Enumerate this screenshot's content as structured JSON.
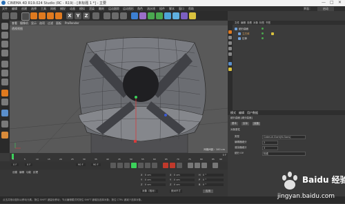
{
  "window": {
    "title": "CINEMA 4D R19.024 Studio (RC - R19) - [未标题 1 *] - 主要",
    "controls": [
      "—",
      "□",
      "✕"
    ]
  },
  "menubar": {
    "items": [
      "文件",
      "编辑",
      "创建",
      "选择",
      "工具",
      "网格",
      "捕捉",
      "动画",
      "模拟",
      "渲染",
      "雕刻",
      "运动跟踪",
      "运动图形",
      "角色",
      "流水线",
      "插件",
      "脚本",
      "窗口",
      "帮助"
    ],
    "layout_label": "界面：",
    "layout_value": "启动"
  },
  "toolbar": {
    "axis_x": "X",
    "axis_y": "Y",
    "axis_z": "Z"
  },
  "viewport": {
    "menu": [
      "查看",
      "摄像机",
      "显示",
      "选项",
      "过滤",
      "面板",
      "ProRender"
    ],
    "label": "透视视图",
    "grid_info": "网格间距：100 cm"
  },
  "object_manager": {
    "menu": [
      "文件",
      "编辑",
      "查看",
      "对象",
      "标签",
      "书签"
    ],
    "objects": [
      {
        "name": "细分曲面",
        "icon_color": "#6fa0d8"
      },
      {
        "name": "立方体",
        "icon_color": "#6fa0d8"
      },
      {
        "name": "拉伸",
        "icon_color": "#6fa0d8"
      }
    ]
  },
  "attribute_manager": {
    "tabs": [
      "模式",
      "编辑",
      "用户数据"
    ],
    "object_title": "细分曲面 [细分曲面]",
    "subtabs": [
      "基本",
      "坐标",
      "对象"
    ],
    "section": "对象属性",
    "fields": [
      {
        "label": "类型",
        "value": "Catmull-Clark(N-Gons)"
      },
      {
        "label": "编辑器细分",
        "value": "2"
      },
      {
        "label": "渲染器细分",
        "value": "3"
      },
      {
        "label": "细分 UV",
        "value": "标准"
      }
    ]
  },
  "timeline": {
    "ticks": [
      "0",
      "5",
      "10",
      "15",
      "20",
      "25",
      "30",
      "35",
      "40",
      "45",
      "50",
      "55",
      "60",
      "65",
      "70",
      "75",
      "80",
      "85",
      "90"
    ],
    "frame": "0 F"
  },
  "transport": {
    "start": "0 F",
    "current": "0 F",
    "end": "90 F",
    "end2": "90 F"
  },
  "material_manager": {
    "menu": [
      "创建",
      "编辑",
      "功能",
      "纹理"
    ]
  },
  "coord_manager": {
    "rows": [
      {
        "axis": "X",
        "value": "0 cm",
        "axis2": "X",
        "value2": "0 cm",
        "axis3": "H",
        "value3": "0 °"
      },
      {
        "axis": "Y",
        "value": "0 cm",
        "axis2": "Y",
        "value2": "0 cm",
        "axis3": "P",
        "value3": "0 °"
      },
      {
        "axis": "Z",
        "value": "0 cm",
        "axis2": "Z",
        "value2": "0 cm",
        "axis3": "B",
        "value3": "0 °"
      }
    ],
    "mode": "对象（相对）",
    "mode2": "绝对尺寸",
    "apply": "应用"
  },
  "statusbar": {
    "text": "点击并拖动鼠标以移动元素。按住 SHIFT 键量化移动；节点编辑模式时按住 SHIFT 键增加选择对象；按住 CTRL 键减少选择对象。"
  },
  "watermark": {
    "brand": "Baidu 经验",
    "url": "jingyan.baidu.com"
  },
  "colors": {
    "accent": "#e07a1f",
    "viewport_bg": "#595959",
    "panel_bg": "#3a3a3a"
  }
}
